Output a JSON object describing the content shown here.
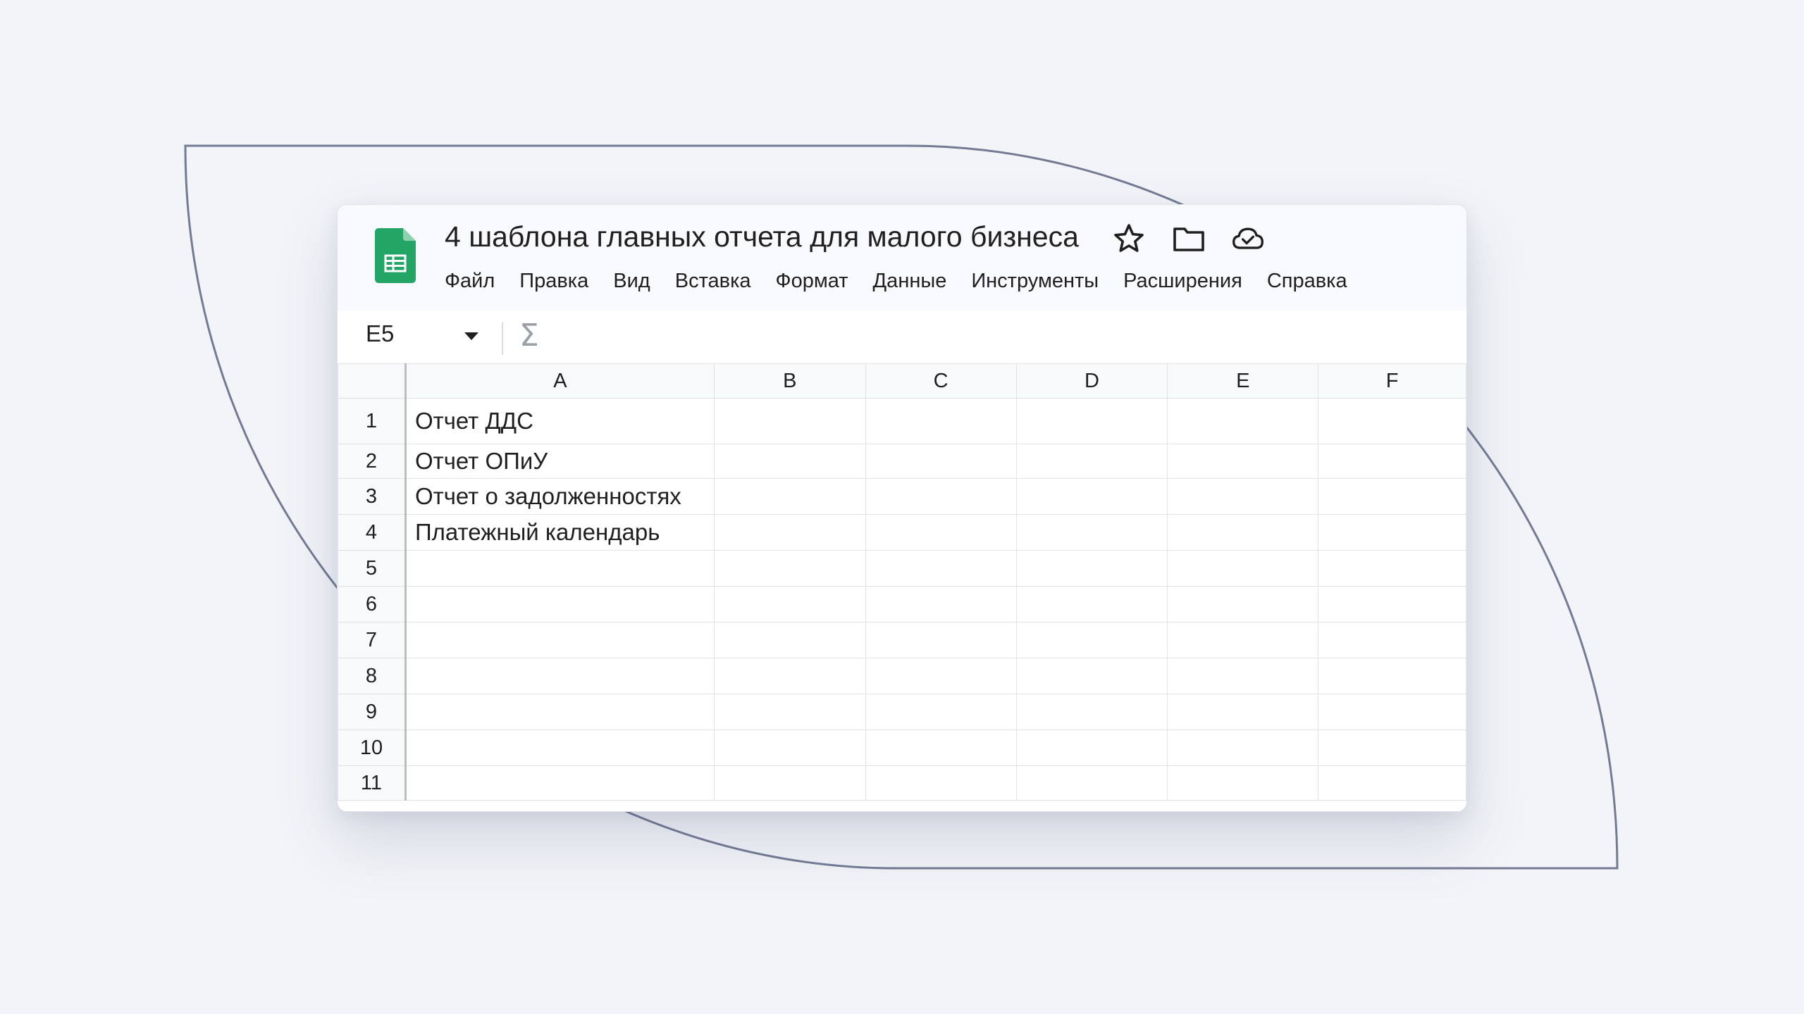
{
  "app": {
    "title": "4 шаблона главных отчета для малого бизнеса",
    "logo_icon": "google-sheets-icon",
    "title_icons": [
      "star-icon",
      "folder-icon",
      "cloud-check-icon"
    ]
  },
  "menu": {
    "items": [
      "Файл",
      "Правка",
      "Вид",
      "Вставка",
      "Формат",
      "Данные",
      "Инструменты",
      "Расширения",
      "Справка"
    ]
  },
  "formula_bar": {
    "name_box": "E5",
    "function_icon": "sigma-icon"
  },
  "grid": {
    "columns": [
      "A",
      "B",
      "C",
      "D",
      "E",
      "F"
    ],
    "rows": [
      {
        "num": "1",
        "cells": [
          "Отчет ДДС",
          "",
          "",
          "",
          "",
          ""
        ]
      },
      {
        "num": "2",
        "cells": [
          "Отчет ОПиУ",
          "",
          "",
          "",
          "",
          ""
        ]
      },
      {
        "num": "3",
        "cells": [
          "Отчет о задолженностях",
          "",
          "",
          "",
          "",
          ""
        ]
      },
      {
        "num": "4",
        "cells": [
          "Платежный календарь",
          "",
          "",
          "",
          "",
          ""
        ]
      },
      {
        "num": "5",
        "cells": [
          "",
          "",
          "",
          "",
          "",
          ""
        ]
      },
      {
        "num": "6",
        "cells": [
          "",
          "",
          "",
          "",
          "",
          ""
        ]
      },
      {
        "num": "7",
        "cells": [
          "",
          "",
          "",
          "",
          "",
          ""
        ]
      },
      {
        "num": "8",
        "cells": [
          "",
          "",
          "",
          "",
          "",
          ""
        ]
      },
      {
        "num": "9",
        "cells": [
          "",
          "",
          "",
          "",
          "",
          ""
        ]
      },
      {
        "num": "10",
        "cells": [
          "",
          "",
          "",
          "",
          "",
          ""
        ]
      },
      {
        "num": "11",
        "cells": [
          "",
          "",
          "",
          "",
          "",
          ""
        ]
      }
    ]
  },
  "colors": {
    "background": "#f2f4f8",
    "sheets_green": "#23a566",
    "outline_stroke": "#737b94"
  }
}
